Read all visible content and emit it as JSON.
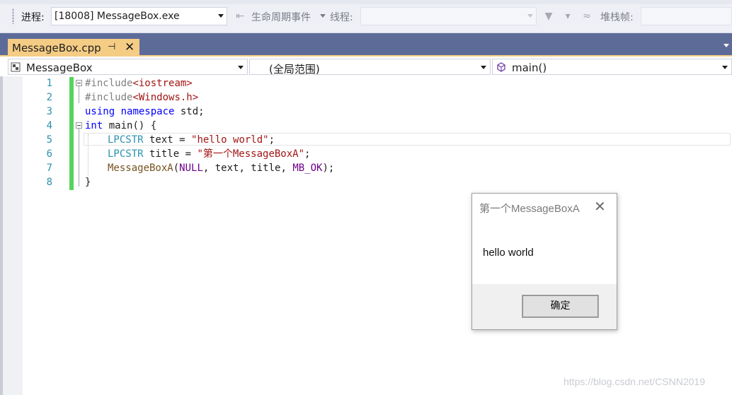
{
  "toolbar": {
    "process_label": "进程:",
    "process_value": "[18008] MessageBox.exe",
    "lifecycle_label": "生命周期事件",
    "thread_label": "线程:",
    "thread_value": "",
    "stackframe_label": "堆栈帧:",
    "stackframe_value": ""
  },
  "tabs": [
    {
      "label": "MessageBox.cpp",
      "active": true
    }
  ],
  "navbar": {
    "project": "MessageBox",
    "scope": "(全局范围)",
    "member": "main()"
  },
  "editor": {
    "line_numbers": [
      "1",
      "2",
      "3",
      "4",
      "5",
      "6",
      "7",
      "8"
    ],
    "lines": {
      "l1": {
        "directive": "#include",
        "header": "<iostream>"
      },
      "l2": {
        "directive": "#include",
        "header": "<Windows.h>"
      },
      "l3": {
        "kw1": "using",
        "kw2": "namespace",
        "rest": " std;"
      },
      "l4": {
        "kw": "int",
        "rest": " main() {"
      },
      "l5": {
        "type": "LPCSTR",
        "mid": " text = ",
        "str": "\"hello world\"",
        "end": ";"
      },
      "l6": {
        "type": "LPCSTR",
        "mid": " title = ",
        "str": "\"第一个MessageBoxA\"",
        "end": ";"
      },
      "l7": {
        "fn": "MessageBoxA",
        "p1": "(",
        "m1": "NULL",
        "p2": ", text, title, ",
        "m2": "MB_OK",
        "p3": ");"
      },
      "l8": {
        "text": "}"
      }
    }
  },
  "dialog": {
    "title": "第一个MessageBoxA",
    "message": "hello world",
    "ok_label": "确定"
  },
  "watermark": "https://blog.csdn.net/CSNN2019",
  "colors": {
    "tab_strip": "#5d6b99",
    "active_tab": "#f5cc84",
    "change_bar": "#57d45c",
    "keyword": "#0000ff",
    "type": "#2b91af",
    "string": "#a31515",
    "macro": "#6f008a"
  }
}
